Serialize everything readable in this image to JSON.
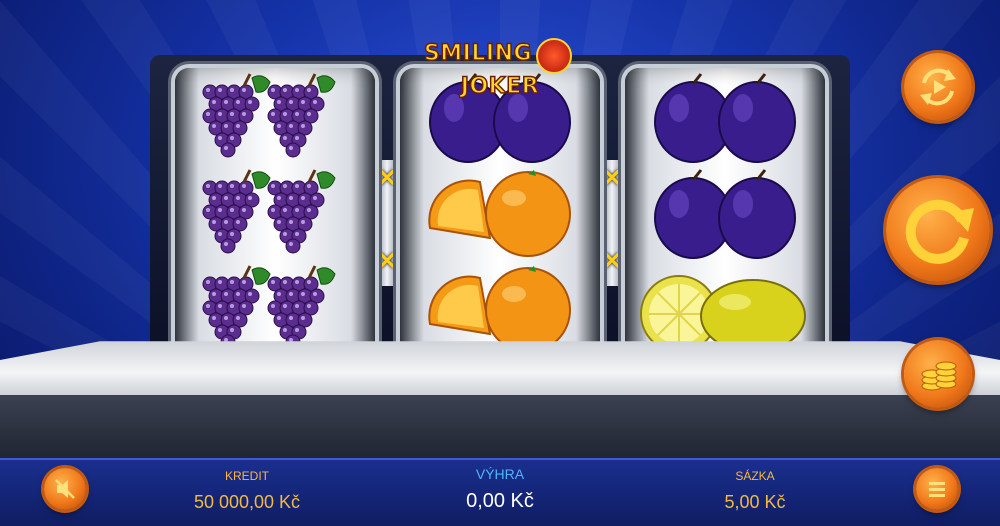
{
  "game": {
    "logo_text_left": "SMILING",
    "logo_text_right": "JOKER"
  },
  "reels": [
    {
      "symbols": [
        "grapes",
        "grapes",
        "grapes"
      ]
    },
    {
      "symbols": [
        "plum",
        "orange",
        "orange"
      ]
    },
    {
      "symbols": [
        "plum",
        "plum",
        "lemon"
      ]
    }
  ],
  "paylines": {
    "markers": [
      "✕",
      "✕",
      "✕",
      "✕"
    ]
  },
  "controls": {
    "autoplay_icon": "autoplay-icon",
    "spin_icon": "spin-icon",
    "bet_icon": "coins-icon",
    "mute_icon": "sound-muted-icon",
    "menu_icon": "menu-icon"
  },
  "status": {
    "credit_label": "KREDIT",
    "credit_value": "50 000,00 Kč",
    "win_label": "VÝHRA",
    "win_value": "0,00 Kč",
    "bet_label": "SÁZKA",
    "bet_value": "5,00 Kč"
  },
  "colors": {
    "accent": "#f0781a",
    "label": "#f5b83d",
    "win_label": "#4fb4ff",
    "background": "#1533a8"
  }
}
